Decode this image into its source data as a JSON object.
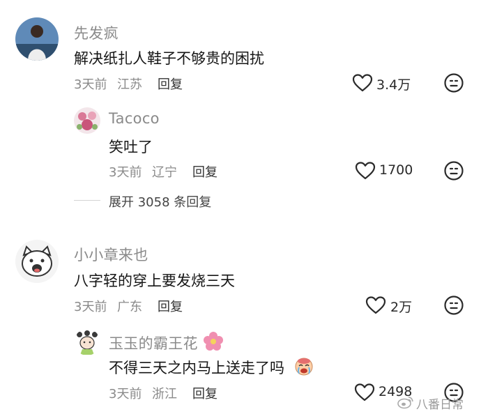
{
  "comments": [
    {
      "name": "先发疯",
      "text": "解决纸扎人鞋子不够贵的困扰",
      "time": "3天前",
      "location": "江苏",
      "reply_label": "回复",
      "likes": "3.4万",
      "replies": [
        {
          "name": "Tacoco",
          "text": "笑吐了",
          "time": "3天前",
          "location": "辽宁",
          "reply_label": "回复",
          "likes": "1700"
        }
      ],
      "expand_label": "展开 3058 条回复"
    },
    {
      "name": "小小章来也",
      "text": "八字轻的穿上要发烧三天",
      "time": "3天前",
      "location": "广东",
      "reply_label": "回复",
      "likes": "2万",
      "replies": [
        {
          "name": "玉玉的霸王花",
          "text": "不得三天之内马上送走了吗",
          "time": "3天前",
          "location": "浙江",
          "reply_label": "回复",
          "likes": "2498"
        }
      ]
    }
  ],
  "watermark": "八番日常",
  "colors": {
    "text": "#161616",
    "secondary": "#8a8a8a",
    "icon": "#2a2a2a"
  },
  "icons": [
    "heart-icon",
    "dislike-face-icon",
    "flower-emoji-icon",
    "crying-emoji-icon",
    "weibo-logo-icon"
  ]
}
